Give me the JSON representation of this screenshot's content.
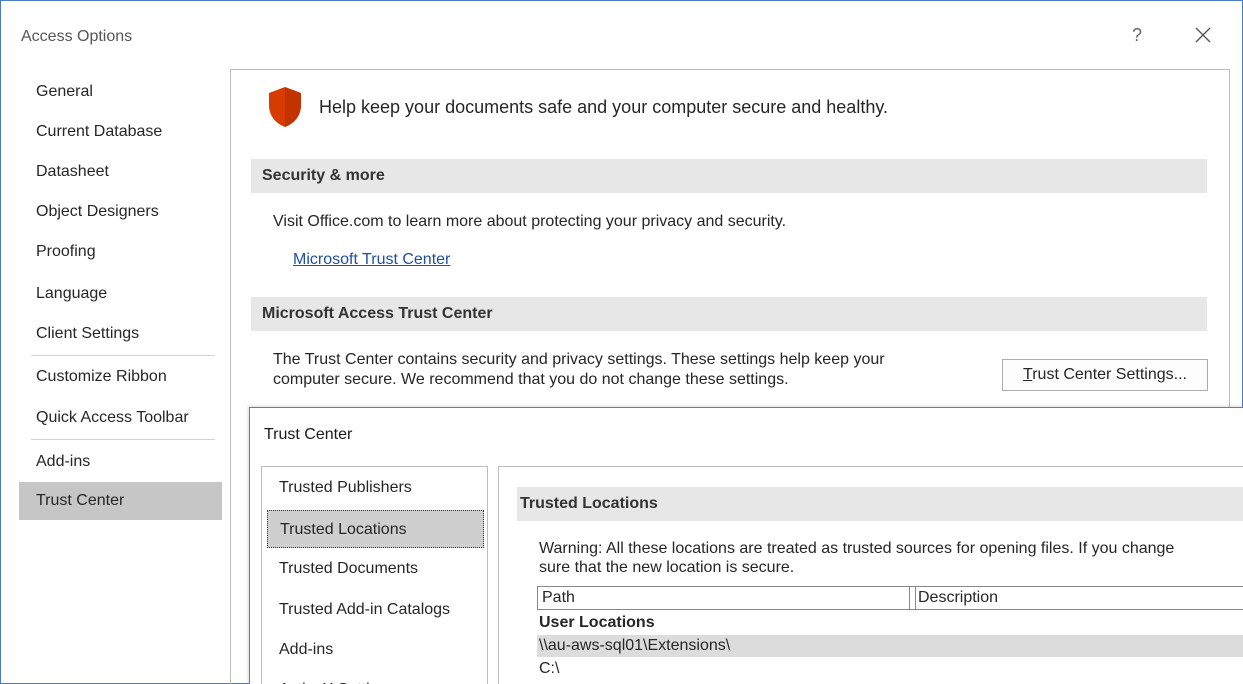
{
  "window": {
    "title": "Access Options",
    "help_label": "?"
  },
  "nav": {
    "items": [
      {
        "label": "General"
      },
      {
        "label": "Current Database"
      },
      {
        "label": "Datasheet"
      },
      {
        "label": "Object Designers"
      },
      {
        "label": "Proofing"
      },
      {
        "label": "Language"
      },
      {
        "label": "Client Settings"
      },
      {
        "label": "Customize Ribbon"
      },
      {
        "label": "Quick Access Toolbar"
      },
      {
        "label": "Add-ins"
      },
      {
        "label": "Trust Center"
      }
    ],
    "selected": "Trust Center"
  },
  "main": {
    "hero_text": "Help keep your documents safe and your computer secure and healthy.",
    "security_section": {
      "heading": "Security & more",
      "text": "Visit Office.com to learn more about protecting your privacy and security.",
      "link": "Microsoft Trust Center"
    },
    "trust_center_section": {
      "heading": "Microsoft Access Trust Center",
      "text_line1": "The Trust Center contains security and privacy settings. These settings help keep your",
      "text_line2": "computer secure. We recommend that you do not change these settings.",
      "button_label_prefix": "T",
      "button_label_rest": "rust Center Settings..."
    }
  },
  "trust_center_dialog": {
    "title": "Trust Center",
    "nav_items": [
      {
        "label": "Trusted Publishers"
      },
      {
        "label": "Trusted Locations"
      },
      {
        "label": "Trusted Documents"
      },
      {
        "label": "Trusted Add-in Catalogs"
      },
      {
        "label": "Add-ins"
      },
      {
        "label": "ActiveX Settings"
      }
    ],
    "selected": "Trusted Locations",
    "section_heading": "Trusted Locations",
    "warning_line1": "Warning: All these locations are treated as trusted sources for opening files.  If you change",
    "warning_line2": "sure that the new location is secure.",
    "table": {
      "columns": [
        "Path",
        "Description"
      ],
      "group_label": "User Locations",
      "rows": [
        {
          "path": "\\\\au-aws-sql01\\Extensions\\"
        },
        {
          "path": "C:\\"
        }
      ]
    }
  },
  "colors": {
    "accent_border": "#4a7cc4",
    "shield_red": "#d83b01",
    "link_blue": "#1f4fa5",
    "selected_bg": "#c6c6c6"
  }
}
